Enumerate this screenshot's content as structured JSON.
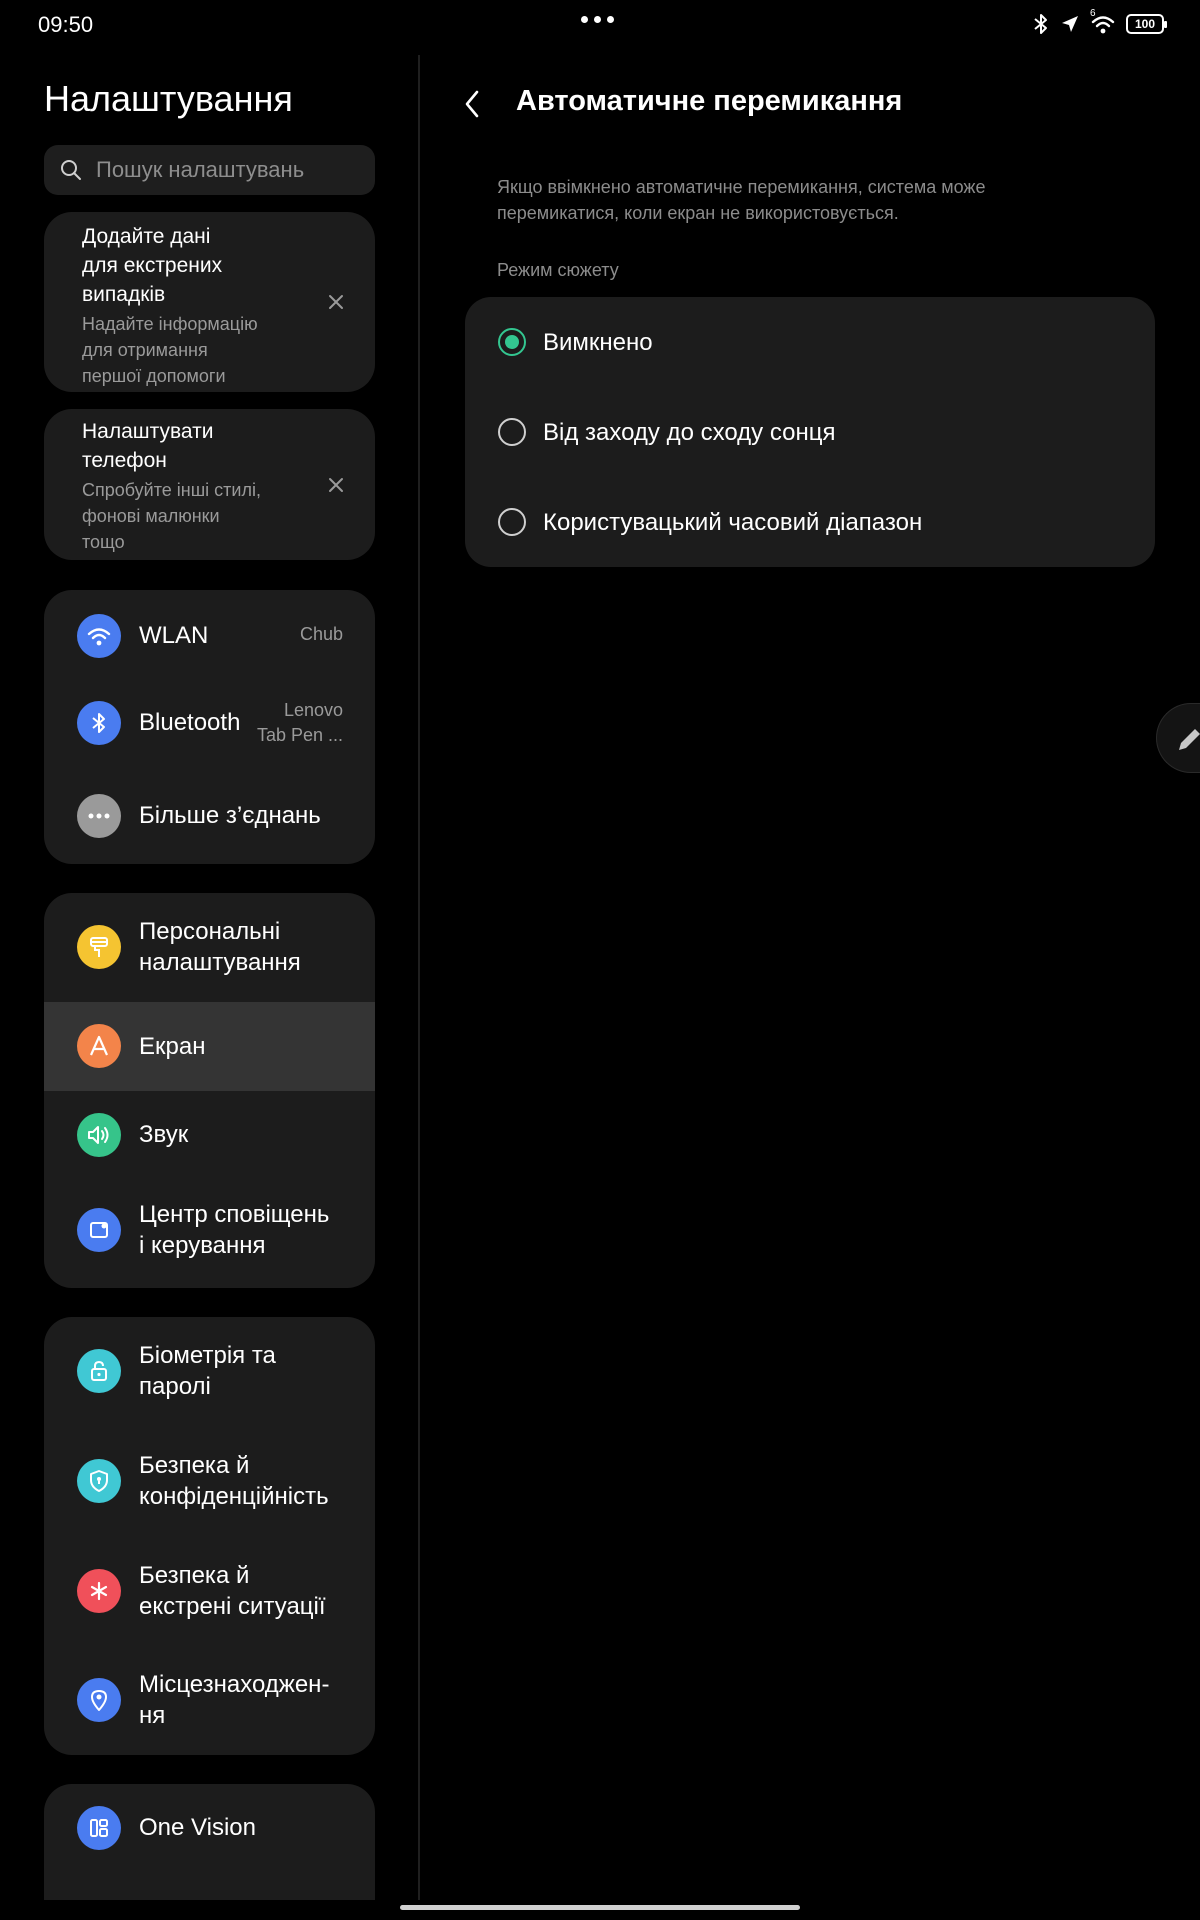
{
  "status": {
    "time": "09:50",
    "battery": "100",
    "signal_label": "6",
    "icons": [
      "bluetooth-icon",
      "location-arrow-icon",
      "wifi-icon",
      "battery-icon"
    ]
  },
  "left": {
    "title": "Налаштування",
    "search_placeholder": "Пошук налаштувань",
    "promos": [
      {
        "title": "Додайте дані\nдля екстрених\nвипадків",
        "subtitle": "Надайте інформацію\nдля отримання\nпершої допомоги"
      },
      {
        "title": "Налаштувати\nтелефон",
        "subtitle": "Спробуйте інші стилі,\nфонові малюнки\nтощо"
      }
    ],
    "groups": [
      {
        "items": [
          {
            "label": "WLAN",
            "value": "Chub",
            "icon": "wifi-icon",
            "color": "#4a7cf0"
          },
          {
            "label": "Bluetooth",
            "value": "Lenovo\nTab Pen ...",
            "icon": "bluetooth-icon",
            "color": "#4a7cf0"
          },
          {
            "label": "Більше з’єднань",
            "value": "",
            "icon": "more-dots-icon",
            "color": "#9a9a9a"
          }
        ]
      },
      {
        "items": [
          {
            "label": "Персональні\nналаштування",
            "icon": "paint-roller-icon",
            "color": "#f5c431"
          },
          {
            "label": "Екран",
            "icon": "display-a-icon",
            "color": "#f3844a",
            "active": true
          },
          {
            "label": "Звук",
            "icon": "speaker-icon",
            "color": "#36c48a"
          },
          {
            "label": "Центр сповіщень\nі керування",
            "icon": "notification-center-icon",
            "color": "#4a7cf0"
          }
        ]
      },
      {
        "items": [
          {
            "label": "Біометрія та\nпаролі",
            "icon": "unlock-icon",
            "color": "#40c8d4"
          },
          {
            "label": "Безпека й\nконфіденційність",
            "icon": "shield-lock-icon",
            "color": "#40c8d4"
          },
          {
            "label": "Безпека й\nекстрені ситуації",
            "icon": "emergency-asterisk-icon",
            "color": "#f0505a"
          },
          {
            "label": "Місцезнаходжен-\nня",
            "icon": "location-pin-icon",
            "color": "#4a7cf0"
          }
        ]
      },
      {
        "items": [
          {
            "label": "One Vision",
            "icon": "layout-grid-icon",
            "color": "#4a7cf0"
          }
        ]
      }
    ]
  },
  "right": {
    "title": "Автоматичне перемикання",
    "description": "Якщо ввімкнено автоматичне перемикання, система може\nперемикатися, коли екран не використовується.",
    "section_label": "Режим сюжету",
    "options": [
      {
        "label": "Вимкнено",
        "checked": true
      },
      {
        "label": "Від заходу до сходу сонця",
        "checked": false
      },
      {
        "label": "Користувацький часовий діапазон",
        "checked": false
      }
    ],
    "accent_color": "#33c690"
  }
}
